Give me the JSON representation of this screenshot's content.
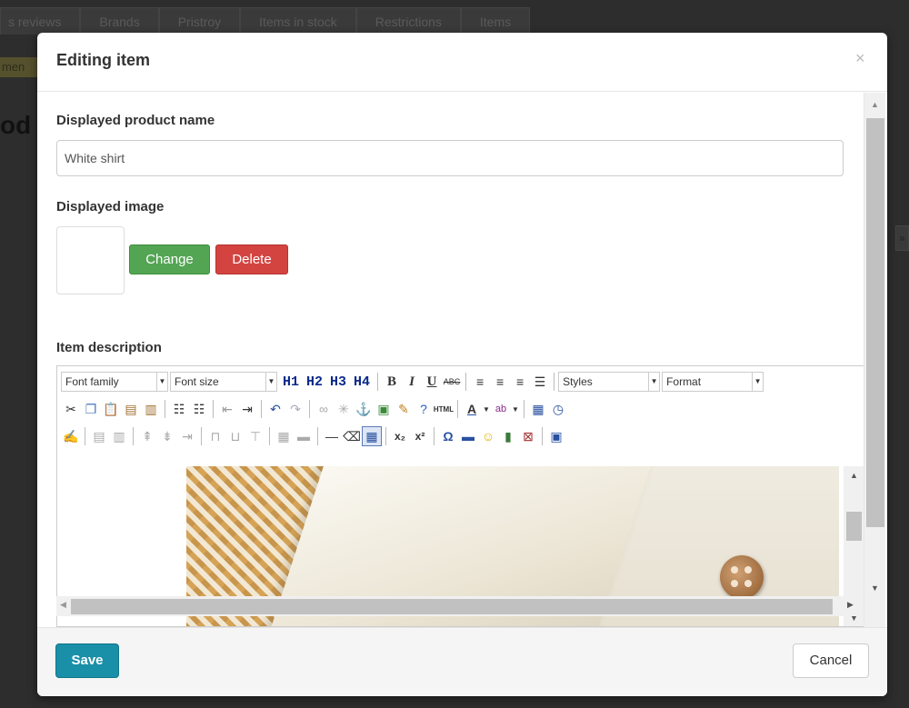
{
  "background": {
    "tabs": [
      "s reviews",
      "Brands",
      "Pristroy",
      "Items in stock",
      "Restrictions",
      "Items"
    ],
    "badge": "men",
    "heading": "od"
  },
  "modal": {
    "title": "Editing item",
    "close_symbol": "×",
    "product_name_label": "Displayed product name",
    "product_name_value": "White shirt",
    "image_label": "Displayed image",
    "change_button": "Change",
    "delete_button": "Delete",
    "description_label": "Item description",
    "editor": {
      "font_family": "Font family",
      "font_size": "Font size",
      "headings": [
        "H1",
        "H2",
        "H3",
        "H4"
      ],
      "styles": "Styles",
      "format": "Format"
    },
    "save_button": "Save",
    "cancel_button": "Cancel"
  },
  "colors": {
    "save": "#1a8fa8",
    "change": "#53a553",
    "delete": "#d34441",
    "heading_buttons": "#0b2a8c"
  }
}
